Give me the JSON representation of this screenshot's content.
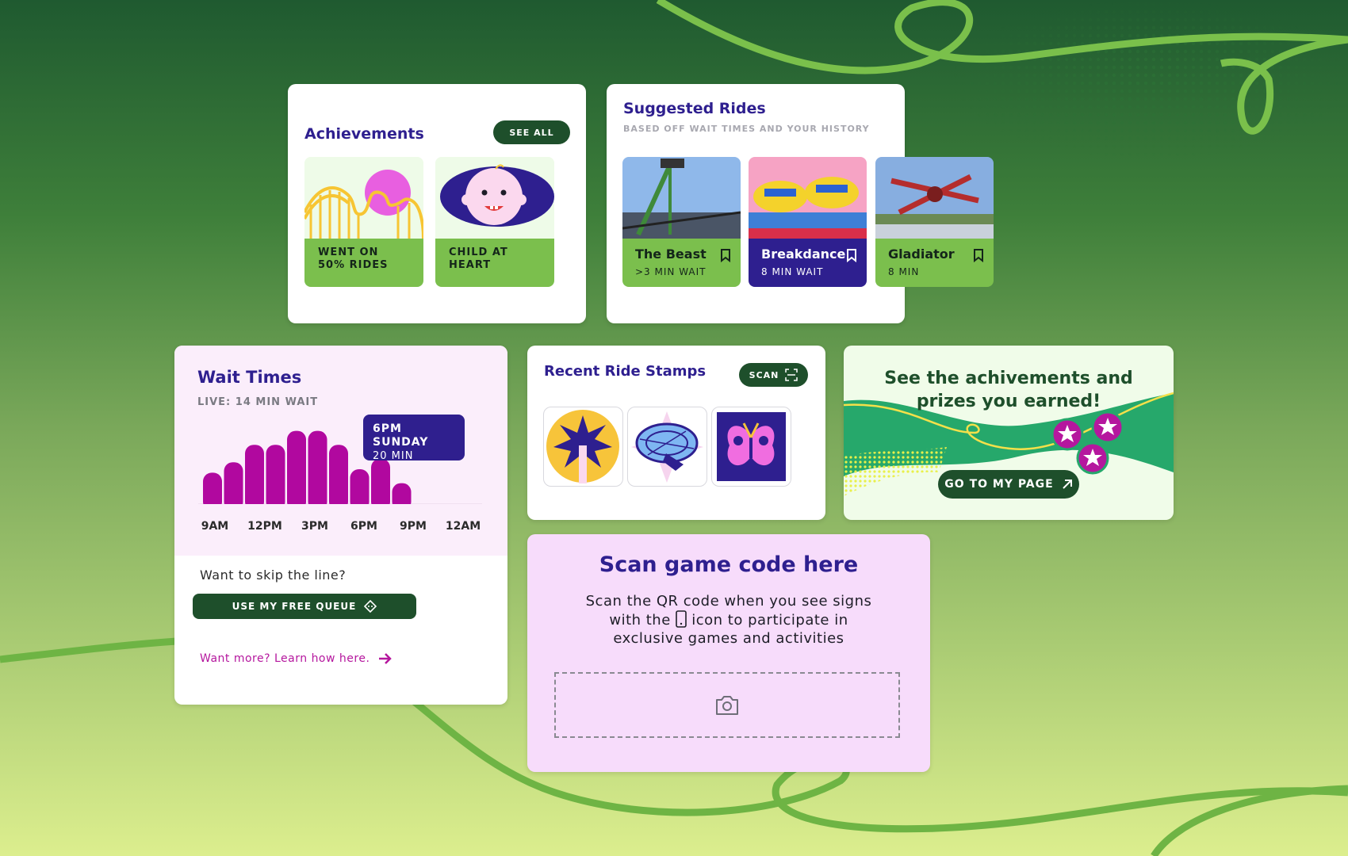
{
  "colors": {
    "brand_dark_green": "#1e4f2b",
    "brand_purple": "#2e1f8f",
    "accent_magenta": "#b5179e",
    "ride_green": "#7bbf4d",
    "background_gradient_top": "#1f5a30",
    "background_gradient_bottom": "#dcee8e"
  },
  "achievements": {
    "title": "Achievements",
    "see_all_label": "SEE ALL",
    "items": [
      {
        "label_line1": "WENT ON",
        "label_line2": "50% RIDES",
        "icon": "roller-coaster-icon"
      },
      {
        "label_line1": "CHILD AT HEART",
        "label_line2": "",
        "icon": "baby-face-icon"
      }
    ]
  },
  "suggested": {
    "title": "Suggested Rides",
    "subtitle": "BASED OFF WAIT TIMES AND YOUR HISTORY",
    "rides": [
      {
        "name": "The Beast",
        "wait": ">3 MIN WAIT",
        "style": "green"
      },
      {
        "name": "Breakdance",
        "wait": "8 MIN WAIT",
        "style": "purple"
      },
      {
        "name": "Gladiator",
        "wait": "8 MIN",
        "style": "green"
      }
    ]
  },
  "wait_times": {
    "title": "Wait Times",
    "live": "LIVE: 14 MIN WAIT",
    "tooltip_day": "6PM SUNDAY",
    "tooltip_min": "20 MIN",
    "skip_text": "Want to skip the line?",
    "queue_button": "USE MY FREE QUEUE",
    "learn_more": "Want more? Learn how here."
  },
  "chart_data": {
    "type": "bar",
    "title": "Wait Times",
    "tick_labels": [
      "9AM",
      "12PM",
      "3PM",
      "6PM",
      "9PM",
      "12AM"
    ],
    "values": [
      9,
      12,
      17,
      17,
      21,
      21,
      17,
      10,
      13,
      6
    ],
    "ylim": [
      0,
      25
    ],
    "highlight": {
      "label": "6PM SUNDAY",
      "value": 20
    }
  },
  "stamps": {
    "title": "Recent Ride Stamps",
    "scan_label": "SCAN",
    "items": [
      "drop-tower-stamp-icon",
      "ferris-wheel-stamp-icon",
      "butterfly-stamp-icon"
    ]
  },
  "prizes": {
    "title_line1": "See the achivements and",
    "title_line2": "prizes you earned!",
    "button": "GO TO MY PAGE"
  },
  "scan_game": {
    "title": "Scan game code here",
    "desc_part1": "Scan the QR code when you see signs with the",
    "desc_part2": "icon to participate in exclusive games and activities"
  }
}
